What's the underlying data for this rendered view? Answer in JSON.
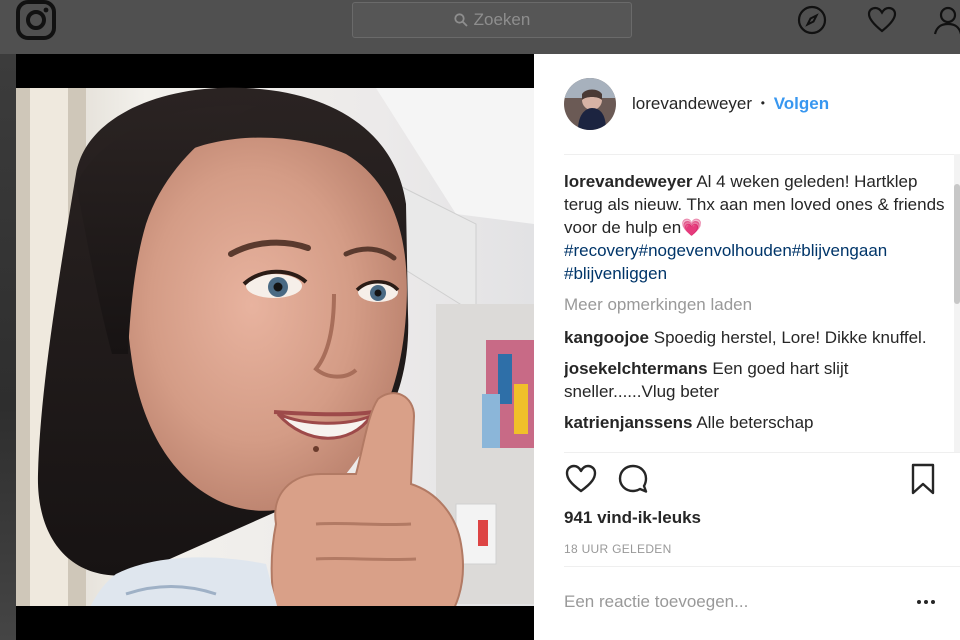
{
  "nav": {
    "search_placeholder": "Zoeken",
    "icons": [
      "instagram-logo-icon",
      "search-icon",
      "compass-icon",
      "heart-icon",
      "profile-icon"
    ]
  },
  "post": {
    "username": "lorevandeweyer",
    "separator": "•",
    "follow_label": "Volgen",
    "caption": {
      "username": "lorevandeweyer",
      "text": "Al 4 weken geleden! Hartklep terug als nieuw. Thx aan men loved ones & friends voor de hulp en💗",
      "hashtags": "#recovery#nogevenvolhouden#blijvengaan #blijvenliggen"
    },
    "load_more_label": "Meer opmerkingen laden",
    "comments": [
      {
        "username": "kangoojoe",
        "text": "Spoedig herstel, Lore! Dikke knuffel."
      },
      {
        "username": "josekelchtermans",
        "text": "Een goed hart slijt sneller......Vlug beter"
      },
      {
        "username": "katrienjanssens",
        "text": "Alle beterschap"
      }
    ],
    "likes": "941 vind-ik-leuks",
    "timestamp": "18 UUR GELEDEN",
    "add_comment_placeholder": "Een reactie toevoegen..."
  },
  "colors": {
    "follow_blue": "#3897f0",
    "hashtag_blue": "#003569",
    "text": "#262626",
    "muted": "#999999"
  }
}
